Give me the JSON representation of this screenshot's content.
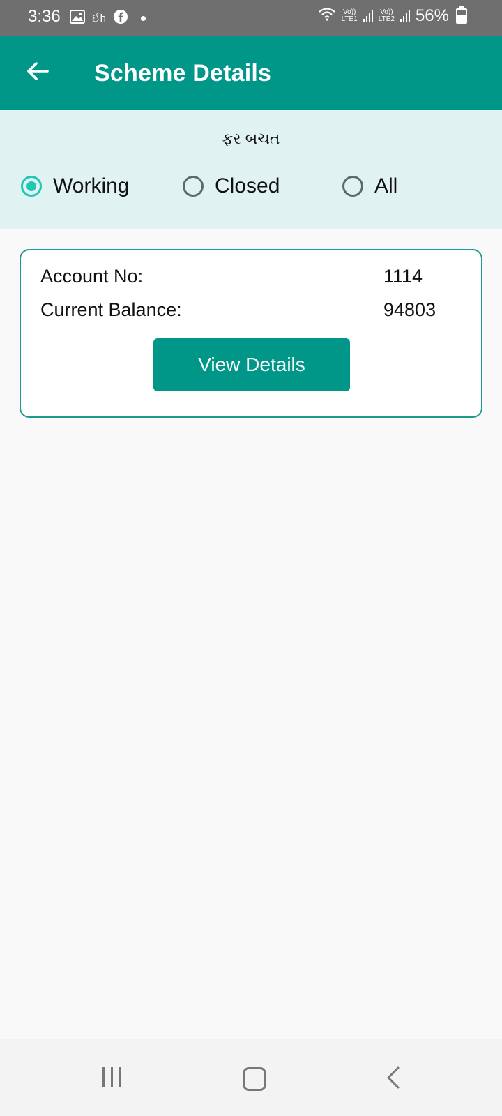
{
  "status_bar": {
    "time": "3:36",
    "notif_text": "ઈh",
    "battery": "56%",
    "sim1": "LTE1",
    "sim2": "LTE2",
    "volte": "Vo))",
    "battery_level": 0.56
  },
  "app_bar": {
    "title": "Scheme Details"
  },
  "scheme_name": "ફર બચત",
  "filters": {
    "selected": "Working",
    "options": [
      {
        "label": "Working",
        "checked": true
      },
      {
        "label": "Closed",
        "checked": false
      },
      {
        "label": "All",
        "checked": false
      }
    ]
  },
  "account_card": {
    "account_no_label": "Account No:",
    "account_no_value": "1114",
    "balance_label": "Current Balance:",
    "balance_value": "94803",
    "button_label": "View Details"
  },
  "colors": {
    "primary": "#009688",
    "panel": "#e0f2f1",
    "radio_checked": "#1fc7b5",
    "status_bar": "#6f6f6f"
  }
}
